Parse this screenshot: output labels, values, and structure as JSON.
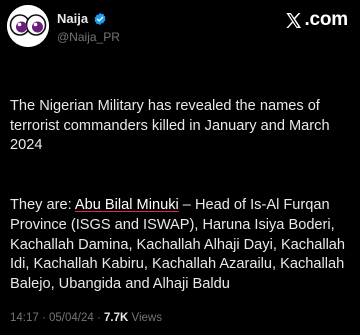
{
  "author": {
    "display_name": "Naija",
    "handle": "@Naija_PR",
    "avatar_icon": "googly-eyes-avatar",
    "verified_icon": "verified-badge-icon",
    "verified_color": "#1d9bf0"
  },
  "brand": {
    "logo_icon": "x-logo-icon",
    "text": ".com"
  },
  "tweet": {
    "paragraph_1": "The Nigerian Military has revealed the names of terrorist commanders killed in January and March 2024",
    "paragraph_2_prefix": "They are: ",
    "highlighted_name": "Abu Bilal Minuki",
    "paragraph_2_rest": " – Head of Is-Al Furqan Province (ISGS and ISWAP),  Haruna Isiya Boderi, Kachallah Damina, Kachallah Alhaji Dayi, Kachallah Idi, Kachallah Kabiru, Kachallah Azarailu, Kachallah Balejo, Ubangida and Alhaji Baldu"
  },
  "meta": {
    "time": "14:17",
    "separator": " · ",
    "date": "05/04/24",
    "views_count": "7.7K",
    "views_label": " Views"
  },
  "colors": {
    "background": "#000000",
    "text_primary": "#e7e9ea",
    "text_secondary": "#71767b",
    "highlight_underline": "#e0245e"
  }
}
